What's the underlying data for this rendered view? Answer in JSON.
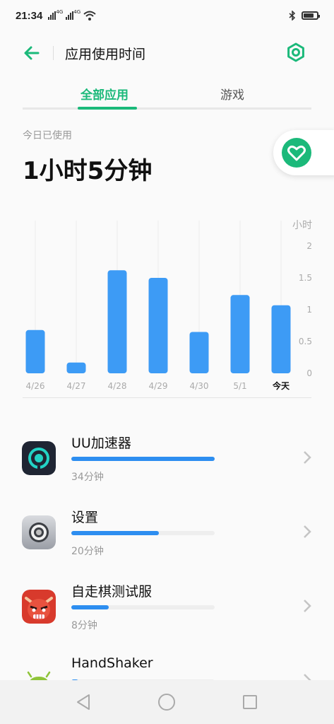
{
  "status_bar": {
    "time": "21:34",
    "network_labels": [
      "4G",
      "4G"
    ],
    "icons": [
      "signal-icon",
      "signal-icon",
      "wifi-icon",
      "bluetooth-icon",
      "battery-icon"
    ],
    "battery_level": 0.75
  },
  "header": {
    "title": "应用使用时间",
    "back_icon": "arrow-left-icon",
    "settings_icon": "gear-icon"
  },
  "tabs": [
    {
      "label": "全部应用",
      "active": true
    },
    {
      "label": "游戏",
      "active": false
    }
  ],
  "summary": {
    "label": "今日已使用",
    "value": "1小时5分钟",
    "badge_icon": "heart-icon"
  },
  "colors": {
    "accent": "#1bb97a",
    "bar": "#3d9bf5",
    "progress": "#2d8ef0"
  },
  "chart_data": {
    "type": "bar",
    "categories": [
      "4/26",
      "4/27",
      "4/28",
      "4/29",
      "4/30",
      "5/1",
      "今天"
    ],
    "values": [
      0.68,
      0.17,
      1.62,
      1.5,
      0.65,
      1.23,
      1.07
    ],
    "ylabel": "小时",
    "ylim": [
      0,
      2
    ],
    "yticks": [
      "0",
      "0.5",
      "1",
      "1.5",
      "2"
    ],
    "grid": true,
    "highlight_category": "今天"
  },
  "apps": [
    {
      "name": "UU加速器",
      "time": "34分钟",
      "progress": 1.0,
      "icon": "uu-accelerator-icon"
    },
    {
      "name": "设置",
      "time": "20分钟",
      "progress": 0.61,
      "icon": "settings-app-icon"
    },
    {
      "name": "自走棋测试服",
      "time": "8分钟",
      "progress": 0.26,
      "icon": "auto-chess-icon"
    },
    {
      "name": "HandShaker",
      "time": "",
      "progress": 0.05,
      "icon": "android-icon"
    }
  ],
  "navbar": {
    "icons": [
      "back-triangle-icon",
      "home-circle-icon",
      "recents-square-icon"
    ]
  }
}
